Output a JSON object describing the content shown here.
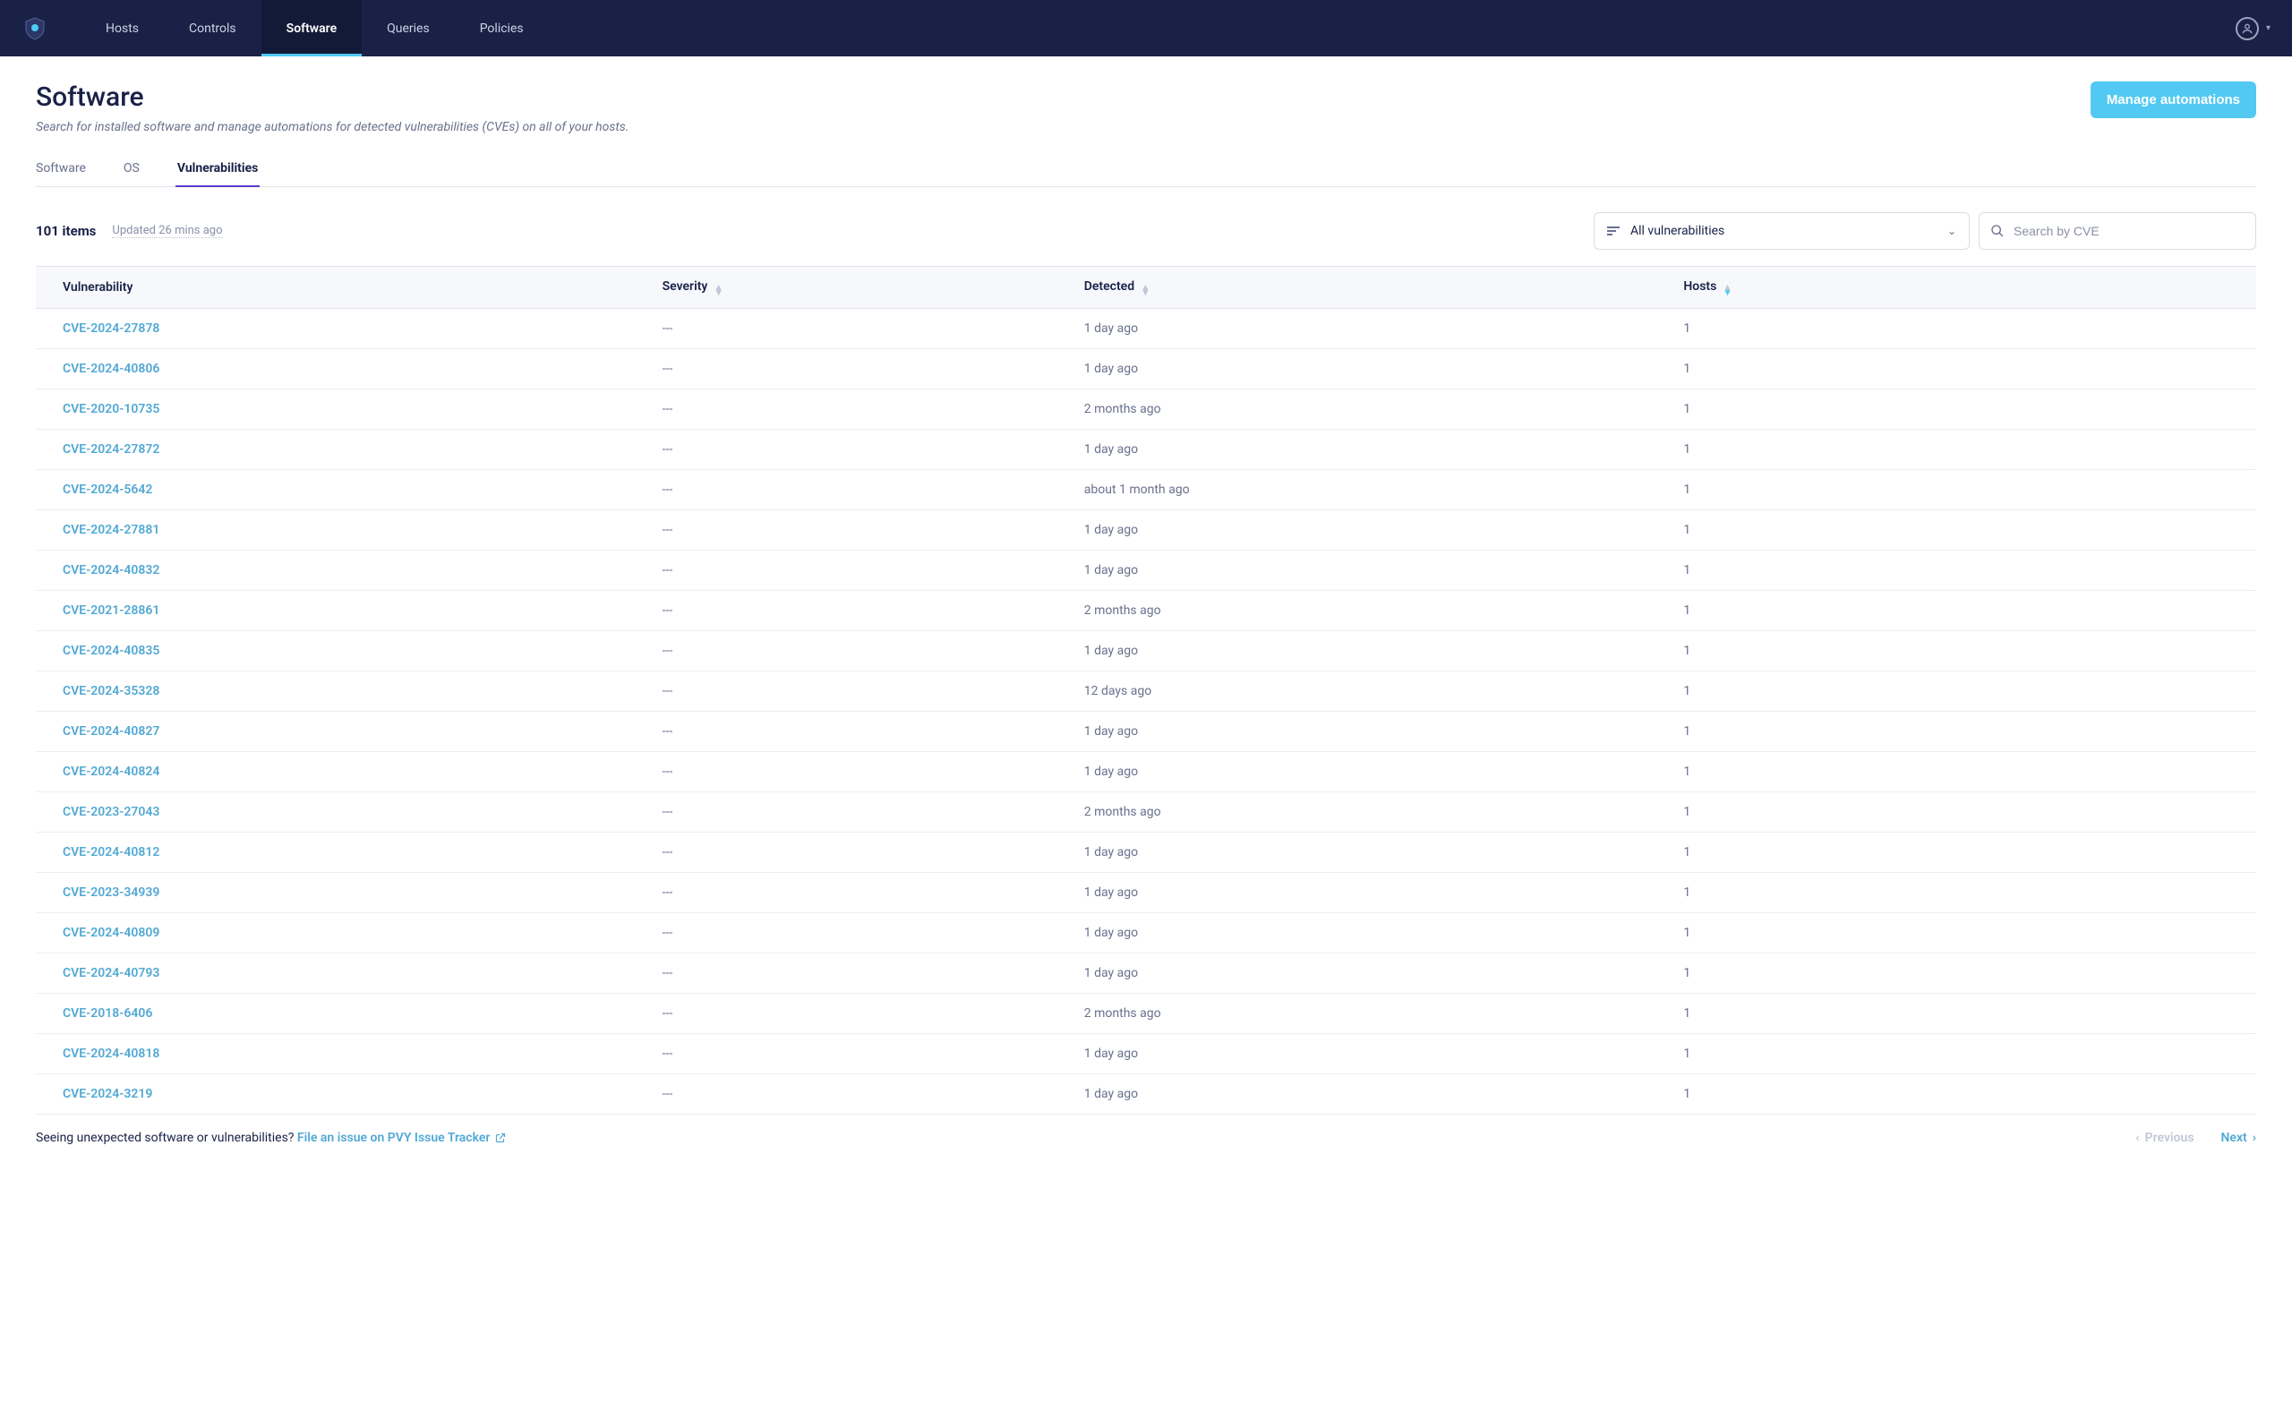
{
  "nav": {
    "items": [
      "Hosts",
      "Controls",
      "Software",
      "Queries",
      "Policies"
    ],
    "active_index": 2
  },
  "header": {
    "title": "Software",
    "subtitle": "Search for installed software and manage automations for detected vulnerabilities (CVEs) on all of your hosts.",
    "button_label": "Manage automations"
  },
  "tabs": {
    "items": [
      "Software",
      "OS",
      "Vulnerabilities"
    ],
    "active_index": 2
  },
  "toolbar": {
    "items_count": "101 items",
    "updated_label": "Updated 26 mins ago",
    "filter_dropdown_label": "All vulnerabilities",
    "search_placeholder": "Search by CVE"
  },
  "table": {
    "columns": {
      "vulnerability": "Vulnerability",
      "severity": "Severity",
      "detected": "Detected",
      "hosts": "Hosts"
    },
    "sorted_column": "hosts",
    "sort_direction": "desc",
    "rows": [
      {
        "cve": "CVE-2024-27878",
        "severity": "---",
        "detected": "1 day ago",
        "hosts": "1"
      },
      {
        "cve": "CVE-2024-40806",
        "severity": "---",
        "detected": "1 day ago",
        "hosts": "1"
      },
      {
        "cve": "CVE-2020-10735",
        "severity": "---",
        "detected": "2 months ago",
        "hosts": "1"
      },
      {
        "cve": "CVE-2024-27872",
        "severity": "---",
        "detected": "1 day ago",
        "hosts": "1"
      },
      {
        "cve": "CVE-2024-5642",
        "severity": "---",
        "detected": "about 1 month ago",
        "hosts": "1"
      },
      {
        "cve": "CVE-2024-27881",
        "severity": "---",
        "detected": "1 day ago",
        "hosts": "1"
      },
      {
        "cve": "CVE-2024-40832",
        "severity": "---",
        "detected": "1 day ago",
        "hosts": "1"
      },
      {
        "cve": "CVE-2021-28861",
        "severity": "---",
        "detected": "2 months ago",
        "hosts": "1"
      },
      {
        "cve": "CVE-2024-40835",
        "severity": "---",
        "detected": "1 day ago",
        "hosts": "1"
      },
      {
        "cve": "CVE-2024-35328",
        "severity": "---",
        "detected": "12 days ago",
        "hosts": "1"
      },
      {
        "cve": "CVE-2024-40827",
        "severity": "---",
        "detected": "1 day ago",
        "hosts": "1"
      },
      {
        "cve": "CVE-2024-40824",
        "severity": "---",
        "detected": "1 day ago",
        "hosts": "1"
      },
      {
        "cve": "CVE-2023-27043",
        "severity": "---",
        "detected": "2 months ago",
        "hosts": "1"
      },
      {
        "cve": "CVE-2024-40812",
        "severity": "---",
        "detected": "1 day ago",
        "hosts": "1"
      },
      {
        "cve": "CVE-2023-34939",
        "severity": "---",
        "detected": "1 day ago",
        "hosts": "1"
      },
      {
        "cve": "CVE-2024-40809",
        "severity": "---",
        "detected": "1 day ago",
        "hosts": "1"
      },
      {
        "cve": "CVE-2024-40793",
        "severity": "---",
        "detected": "1 day ago",
        "hosts": "1"
      },
      {
        "cve": "CVE-2018-6406",
        "severity": "---",
        "detected": "2 months ago",
        "hosts": "1"
      },
      {
        "cve": "CVE-2024-40818",
        "severity": "---",
        "detected": "1 day ago",
        "hosts": "1"
      },
      {
        "cve": "CVE-2024-3219",
        "severity": "---",
        "detected": "1 day ago",
        "hosts": "1"
      }
    ]
  },
  "footer": {
    "note_prefix": "Seeing unexpected software or vulnerabilities? ",
    "link_label": "File an issue on PVY Issue Tracker",
    "previous_label": "Previous",
    "next_label": "Next"
  }
}
